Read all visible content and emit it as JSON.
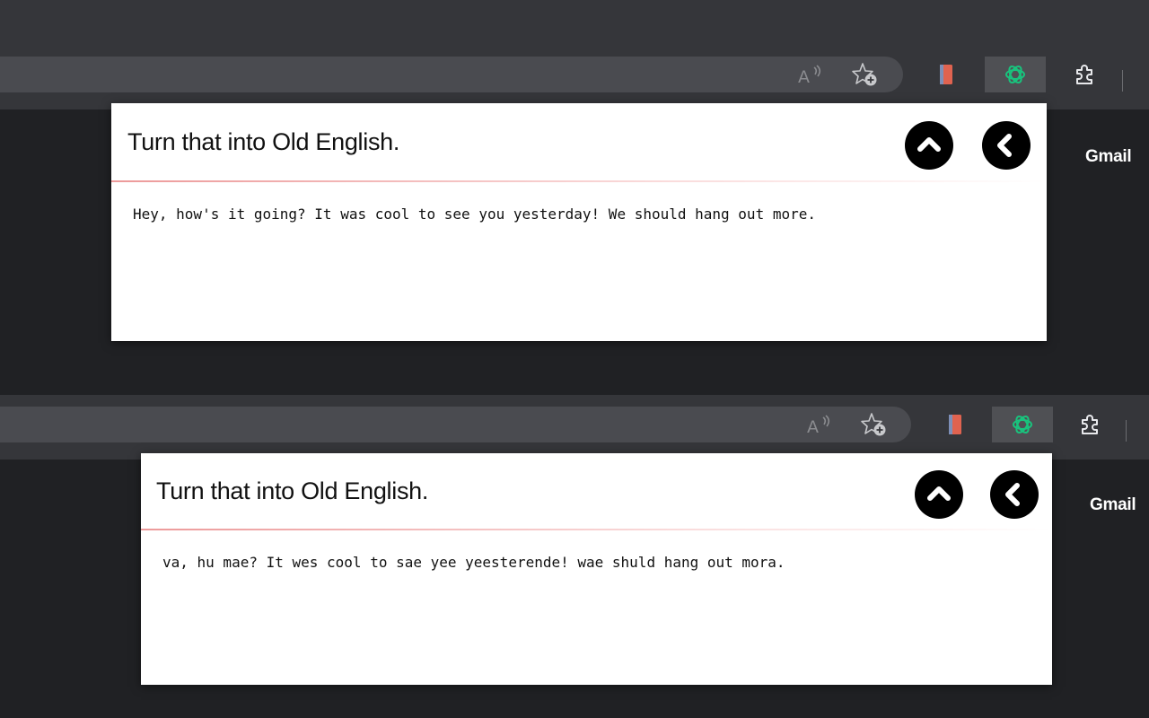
{
  "panels": [
    {
      "id": "before",
      "gmail_label": "Gmail",
      "popup": {
        "title": "Turn that into Old English.",
        "text": "Hey, how's it going? It was cool to see you yesterday! We should hang out more."
      }
    },
    {
      "id": "after",
      "gmail_label": "Gmail",
      "popup": {
        "title": "Turn that into Old English.",
        "text": "va, hu mae? It wes cool to sae yee yeesterende! wae shuld hang out mora."
      }
    }
  ],
  "icons": {
    "read_aloud": "read-aloud-icon",
    "add_favorite": "add-favorite-icon",
    "red_extension": "red-extension-icon",
    "chatgpt_extension": "chatgpt-icon",
    "extensions": "puzzle-icon",
    "collapse": "chevron-up-icon",
    "back": "chevron-left-icon"
  },
  "colors": {
    "page_background": "#202124",
    "toolbar": "#35363a",
    "omnibox": "#4a4b50",
    "chatgpt_green": "#19c37d",
    "red_extension": "#e06350",
    "popup_background": "#ffffff",
    "button_black": "#000000"
  }
}
